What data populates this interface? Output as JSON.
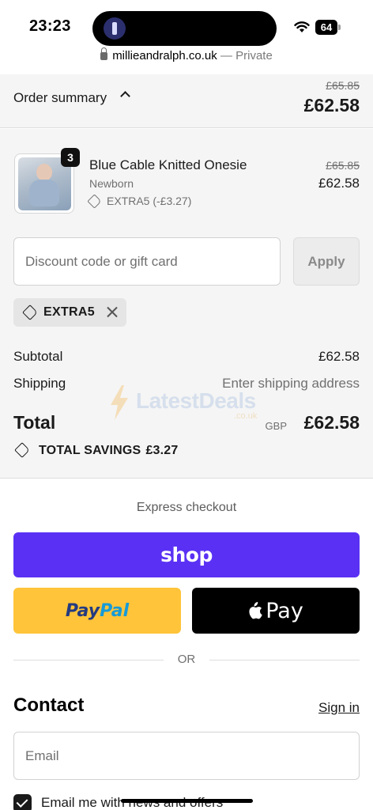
{
  "status_bar": {
    "time": "23:23",
    "battery": "64"
  },
  "browser": {
    "url": "millieandralph.co.uk",
    "mode": "— Private"
  },
  "order_summary": {
    "label": "Order summary",
    "original_total": "£65.85",
    "total": "£62.58"
  },
  "line_item": {
    "quantity": "3",
    "name": "Blue Cable Knitted Onesie",
    "variant": "Newborn",
    "discount": "EXTRA5 (-£3.27)",
    "original_price": "£65.85",
    "price": "£62.58"
  },
  "discount": {
    "placeholder": "Discount code or gift card",
    "apply_label": "Apply",
    "applied_code": "EXTRA5"
  },
  "totals": {
    "subtotal_label": "Subtotal",
    "subtotal_value": "£62.58",
    "shipping_label": "Shipping",
    "shipping_value": "Enter shipping address",
    "total_label": "Total",
    "currency": "GBP",
    "total_value": "£62.58",
    "savings_label": "TOTAL SAVINGS",
    "savings_value": "£3.27"
  },
  "watermark": {
    "brand": "LatestDeals",
    "domain": ".co.uk"
  },
  "express_checkout": {
    "label": "Express checkout",
    "shop_label": "shop",
    "paypal_part1": "Pay",
    "paypal_part2": "Pal",
    "applepay_label": "Pay",
    "or_label": "OR"
  },
  "contact": {
    "title": "Contact",
    "signin_label": "Sign in",
    "email_placeholder": "Email",
    "newsletter_label": "Email me with news and offers"
  },
  "colors": {
    "shop_purple": "#5a31f4",
    "paypal_yellow": "#ffc439",
    "paypal_dark_blue": "#253b80",
    "paypal_light_blue": "#179bd7",
    "summary_bg": "#f5f5f5"
  }
}
